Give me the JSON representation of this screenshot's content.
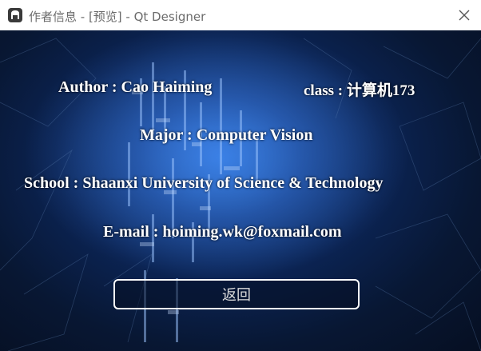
{
  "window": {
    "title": "作者信息 - [预览] - Qt Designer"
  },
  "info": {
    "author": "Author : Cao Haiming",
    "class": "class : 计算机173",
    "major": "Major : Computer Vision",
    "school": "School : Shaanxi University of Science & Technology",
    "email": "E-mail : hoiming.wk@foxmail.com"
  },
  "actions": {
    "back_label": "返回"
  },
  "icons": {
    "app": "qt-designer-icon",
    "close": "close-icon"
  },
  "colors": {
    "text": "#ffffff",
    "background_center": "#2a6fc9",
    "background_edge": "#060f22",
    "title_text": "#6b6b6b"
  }
}
